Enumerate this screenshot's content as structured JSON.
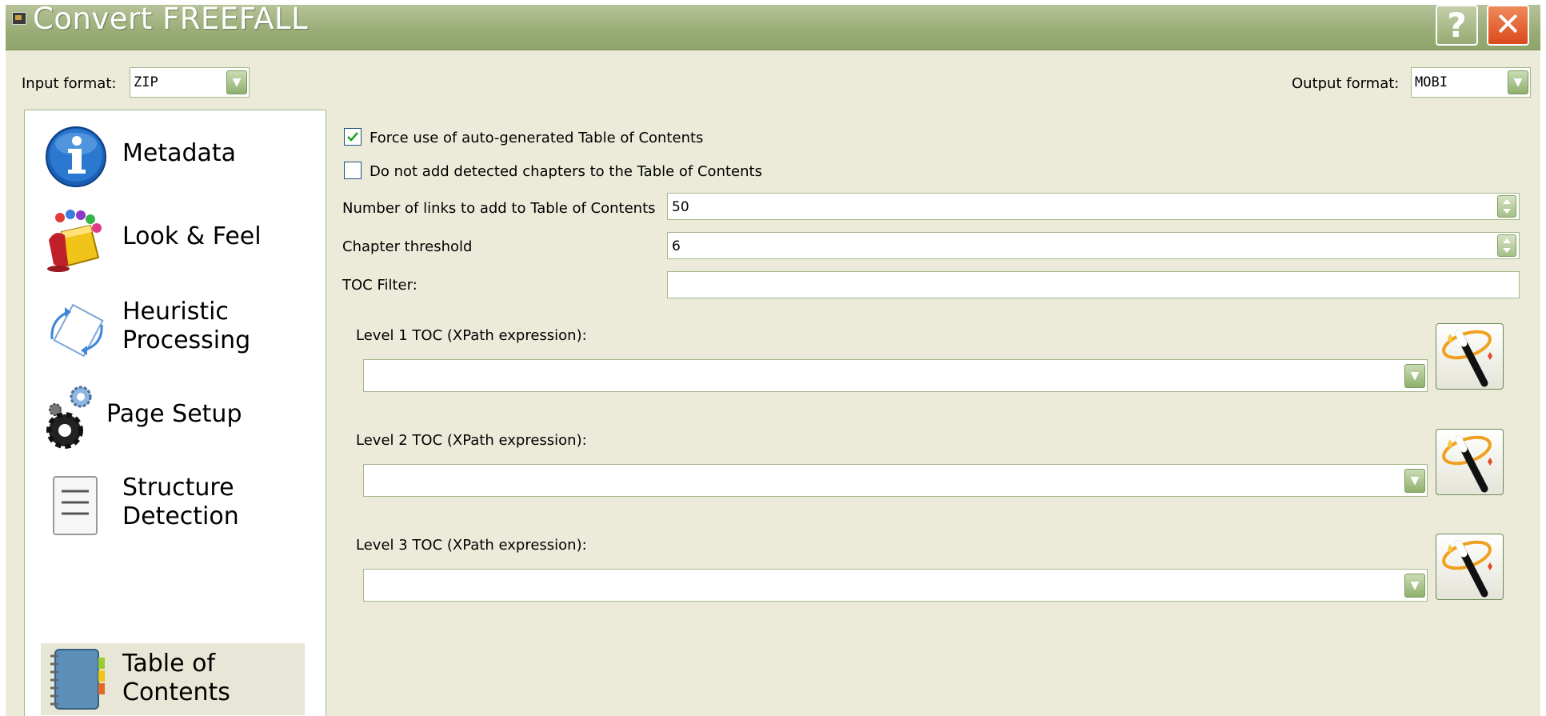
{
  "window": {
    "title": "Convert FREEFALL"
  },
  "titlebar": {
    "help_glyph": "?",
    "close_glyph": "✕"
  },
  "input_format": {
    "label": "Input format:",
    "value": "ZIP"
  },
  "output_format": {
    "label": "Output format:",
    "value": "MOBI"
  },
  "sidebar": {
    "items": [
      {
        "lines": [
          "Metadata"
        ],
        "icon": "info-icon"
      },
      {
        "lines": [
          "Look & Feel"
        ],
        "icon": "paint-bucket-icon"
      },
      {
        "lines": [
          "Heuristic",
          "Processing"
        ],
        "icon": "rotate-page-icon"
      },
      {
        "lines": [
          "Page Setup"
        ],
        "icon": "gears-icon"
      },
      {
        "lines": [
          "Structure",
          "Detection"
        ],
        "icon": "document-icon"
      },
      {
        "lines": [
          "Table of",
          "Contents"
        ],
        "icon": "notebook-icon",
        "selected": true
      }
    ]
  },
  "toc": {
    "force_auto_toc": {
      "label": "Force use of auto-generated Table of Contents",
      "checked": true
    },
    "no_detected_chapters": {
      "label": "Do not add detected chapters to the Table of Contents",
      "checked": false
    },
    "num_links": {
      "label": "Number of links to add to Table of Contents",
      "value": "50"
    },
    "chapter_threshold": {
      "label": "Chapter threshold",
      "value": "6"
    },
    "toc_filter": {
      "label": "TOC Filter:",
      "value": ""
    },
    "levels": [
      {
        "label": "Level 1 TOC (XPath expression):",
        "value": ""
      },
      {
        "label": "Level 2 TOC (XPath expression):",
        "value": ""
      },
      {
        "label": "Level 3 TOC (XPath expression):",
        "value": ""
      }
    ]
  },
  "colors": {
    "titlebar": "#9bae78",
    "close": "#d94a1c",
    "window_bg": "#ecebda",
    "border": "#a5b88a"
  }
}
